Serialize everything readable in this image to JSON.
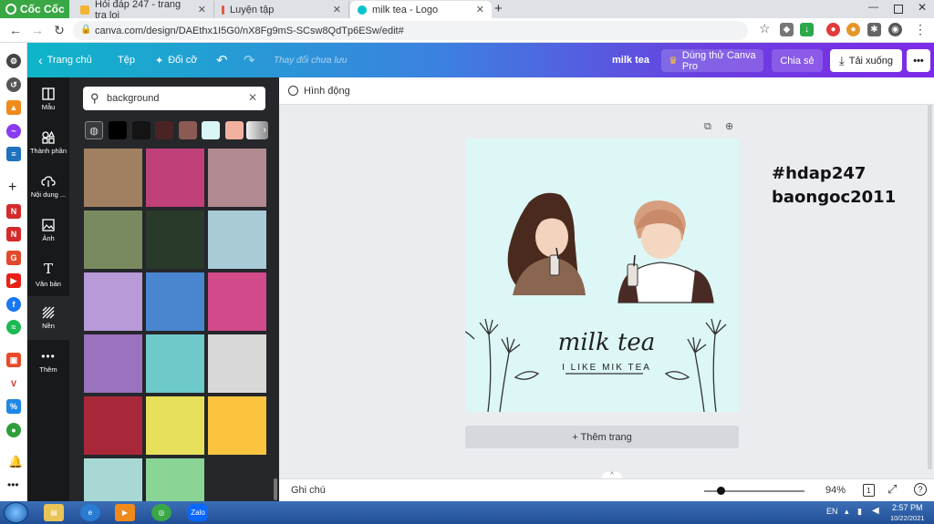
{
  "browser": {
    "brand": "Cốc Cốc",
    "tabs": [
      {
        "title": "Hỏi đáp 247 - trang tra loi",
        "active": false
      },
      {
        "title": "Luyện tập",
        "active": false
      },
      {
        "title": "milk tea - Logo",
        "active": true
      }
    ],
    "url": "canva.com/design/DAEthx1I5G0/nX8Fg9mS-SCsw8QdTp6ESw/edit#"
  },
  "header": {
    "home": "Trang chủ",
    "file": "Tệp",
    "resize": "Đổi cỡ",
    "save_status": "Thay đổi chưa lưu",
    "doc_title": "milk tea",
    "try_pro": "Dùng thử Canva Pro",
    "share": "Chia sẻ",
    "download": "Tải xuống",
    "more": "•••"
  },
  "rail": {
    "items": [
      {
        "label": "Mẫu",
        "icon": "template-icon"
      },
      {
        "label": "Thành phần",
        "icon": "elements-icon"
      },
      {
        "label": "Nội dung ...",
        "icon": "upload-icon"
      },
      {
        "label": "Ảnh",
        "icon": "photo-icon"
      },
      {
        "label": "Văn bản",
        "icon": "text-icon"
      },
      {
        "label": "Nền",
        "icon": "background-icon"
      },
      {
        "label": "Thêm",
        "icon": "more-icon"
      }
    ]
  },
  "panel": {
    "search_value": "background",
    "swatches": [
      "#000000",
      "#141414",
      "#4a2424",
      "#8c5a55",
      "#d8f6f6",
      "#f2b1a0"
    ],
    "tiles": [
      {
        "color": "#a08060"
      },
      {
        "color": "#c0407a"
      },
      {
        "color": "#b08a90"
      },
      {
        "color": "#7a8a60"
      },
      {
        "color": "#2a3a2a"
      },
      {
        "color": "#a8cbd6"
      },
      {
        "color": "#b89ad8"
      },
      {
        "color": "#4a86d0"
      },
      {
        "color": "#d24a8a"
      },
      {
        "color": "#9a72bd"
      },
      {
        "color": "#6ec9c9"
      },
      {
        "color": "#d8d8d8"
      },
      {
        "color": "#a8283a"
      },
      {
        "color": "#e6e05a"
      },
      {
        "color": "#fbc440"
      },
      {
        "color": "#a7d8d3"
      },
      {
        "color": "#8ad595"
      }
    ]
  },
  "workspace": {
    "animate": "Hình động",
    "logo_title": "milk tea",
    "logo_subtitle": "I LIKE MIK TEA",
    "add_page": "+ Thêm trang",
    "watermark_line1": "#hdap247",
    "watermark_line2": "baongoc2011"
  },
  "footer": {
    "notes": "Ghi chú",
    "zoom": "94%",
    "page_num": "1",
    "help": "?"
  },
  "taskbar": {
    "lang": "EN",
    "time": "2:57 PM",
    "date": "10/22/2021"
  },
  "colors": {
    "accent": "#7d2ae8",
    "canvas_bg": "#dcf7f6"
  }
}
